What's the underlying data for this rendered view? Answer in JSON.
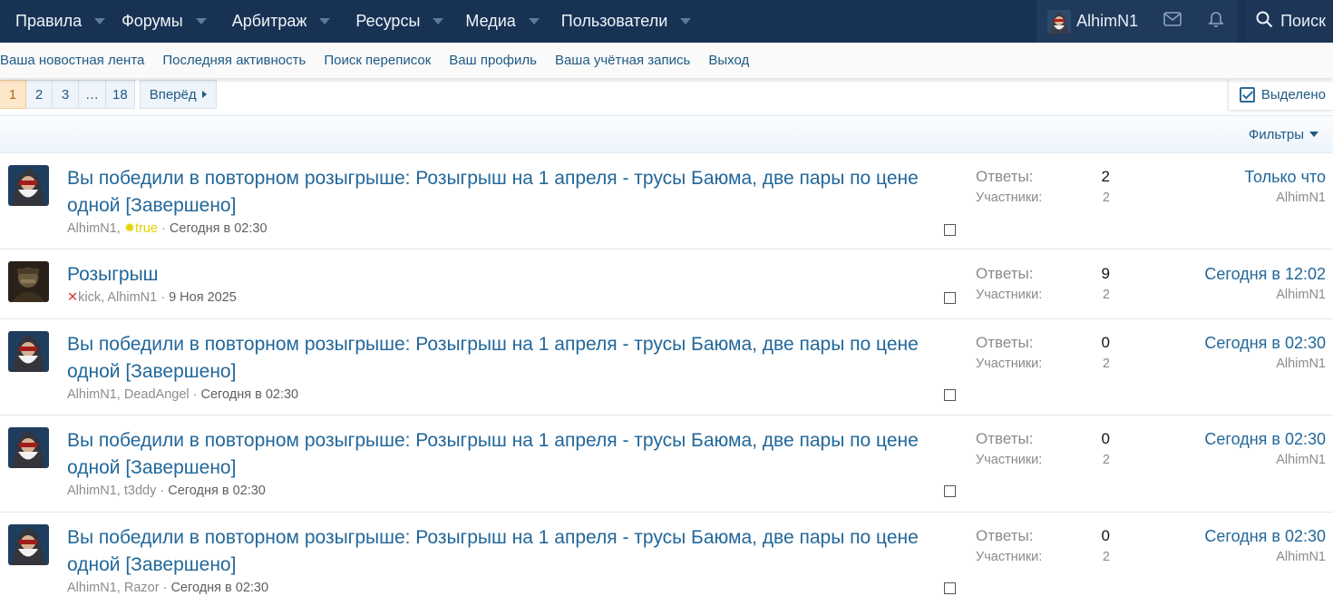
{
  "nav": {
    "items": [
      {
        "label": "Правила"
      },
      {
        "label": "Форумы"
      },
      {
        "label": "Арбитраж"
      },
      {
        "label": "Ресурсы"
      },
      {
        "label": "Медиа"
      },
      {
        "label": "Пользователи"
      }
    ],
    "user": "AlhimN1",
    "inbox_icon": "envelope-icon",
    "alerts_icon": "bell-icon",
    "search_label": "Поиск"
  },
  "subnav": {
    "links": [
      "Ваша новостная лента",
      "Последняя активность",
      "Поиск переписок",
      "Ваш профиль",
      "Ваша учётная запись",
      "Выход"
    ]
  },
  "pagination": {
    "pages": [
      "1",
      "2",
      "3",
      "…",
      "18"
    ],
    "current": "1",
    "next_label": "Вперёд"
  },
  "highlight_label": "Выделено",
  "filters_label": "Фильтры",
  "labels": {
    "replies": "Ответы:",
    "participants": "Участники:"
  },
  "conversations": [
    {
      "title_line1": "Вы победили в повторном розыгрыше: Розыгрыш на 1 апреля - трусы Баюма, две пары по цене",
      "title_line2": "одной [Завершено]",
      "starter": "AlhimN1,",
      "others": "true",
      "date": "Сегодня в 02:30",
      "replies": "2",
      "participants": "2",
      "last_date": "Только что",
      "last_user": "AlhimN1"
    },
    {
      "title_line1": "Розыгрыш",
      "title_line2": "",
      "starter": "kick,",
      "others": "AlhimN1",
      "date": "9 Ноя 2025",
      "replies": "9",
      "participants": "2",
      "last_date": "Сегодня в 12:02",
      "last_user": "AlhimN1"
    },
    {
      "title_line1": "Вы победили в повторном розыгрыше: Розыгрыш на 1 апреля - трусы Баюма, две пары по цене",
      "title_line2": "одной [Завершено]",
      "starter": "AlhimN1,",
      "others": "DeadAngel",
      "date": "Сегодня в 02:30",
      "replies": "0",
      "participants": "2",
      "last_date": "Сегодня в 02:30",
      "last_user": "AlhimN1"
    },
    {
      "title_line1": "Вы победили в повторном розыгрыше: Розыгрыш на 1 апреля - трусы Баюма, две пары по цене",
      "title_line2": "одной [Завершено]",
      "starter": "AlhimN1,",
      "others": "t3ddy",
      "date": "Сегодня в 02:30",
      "replies": "0",
      "participants": "2",
      "last_date": "Сегодня в 02:30",
      "last_user": "AlhimN1"
    },
    {
      "title_line1": "Вы победили в повторном розыгрыше: Розыгрыш на 1 апреля - трусы Баюма, две пары по цене",
      "title_line2": "одной [Завершено]",
      "starter": "AlhimN1,",
      "others": "Razor",
      "date": "Сегодня в 02:30",
      "replies": "0",
      "participants": "2",
      "last_date": "Сегодня в 02:30",
      "last_user": "AlhimN1"
    }
  ]
}
